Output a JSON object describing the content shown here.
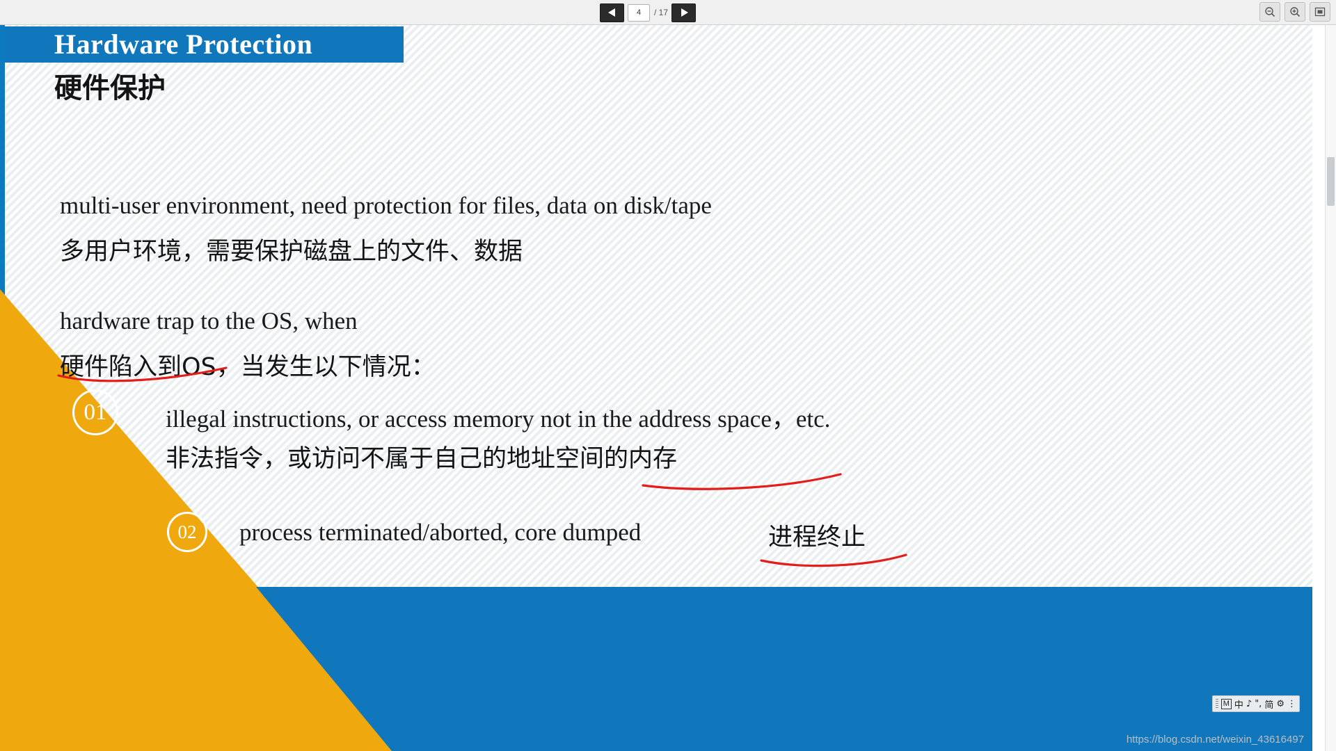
{
  "toolbar": {
    "prev_label": "prev-slide",
    "next_label": "next-slide",
    "current_page": "4",
    "total_pages": "/ 17",
    "zoom_out_label": "zoom-out",
    "zoom_in_label": "zoom-in",
    "fit_label": "fit-page"
  },
  "slide": {
    "title_en": "Hardware Protection",
    "title_cn": "硬件保护",
    "paragraphs": [
      {
        "en": "multi-user environment, need protection for files, data on disk/tape",
        "cn": "多用户环境，需要保护磁盘上的文件、数据"
      },
      {
        "en": "hardware trap to the OS, when",
        "cn": "硬件陷入到OS，当发生以下情况："
      }
    ],
    "bullets": [
      {
        "number": "01",
        "en": "illegal instructions, or access memory not in the address space，etc.",
        "cn": "非法指令，或访问不属于自己的地址空间的内存"
      },
      {
        "number": "02",
        "en": "process terminated/aborted, core dumped ",
        "cn": "进程终止"
      }
    ],
    "colors": {
      "blue": "#1177bd",
      "gold": "#efa90e",
      "ink_red": "#e31d1a"
    }
  },
  "ime": {
    "mode_icon": "M",
    "chinese": "中",
    "note_icon": "♪",
    "punct_icon": "\",",
    "simplified": "简",
    "settings_icon": "⚙",
    "more": "⋮"
  },
  "watermark": {
    "text": "https://blog.csdn.net/weixin_43616497"
  }
}
